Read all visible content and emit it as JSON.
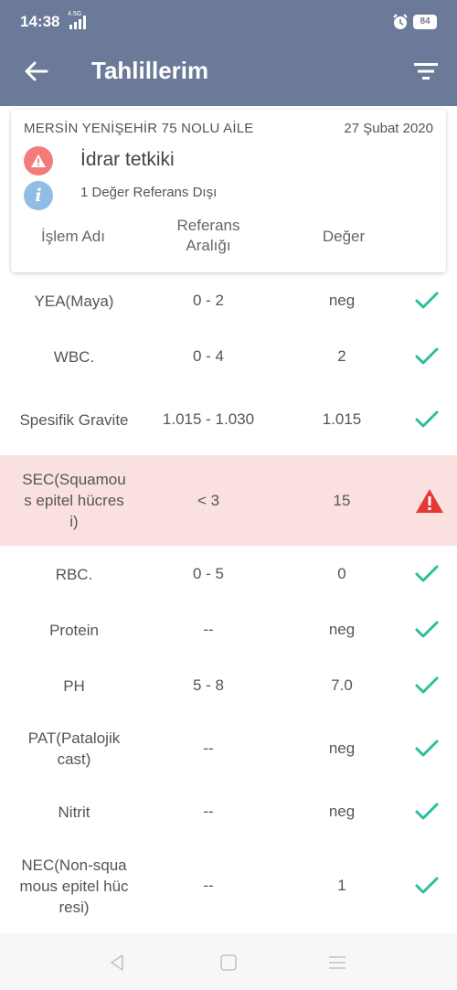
{
  "status_bar": {
    "time": "14:38",
    "network": "4.5G",
    "battery": "84"
  },
  "app_bar": {
    "title": "Tahlillerim"
  },
  "card": {
    "clinic": "MERSİN YENİŞEHİR 75 NOLU AİLE",
    "date": "27 Şubat 2020",
    "test_name": "İdrar tetkiki",
    "reference_summary": "1 Değer Referans Dışı",
    "headers": {
      "name": "İşlem Adı",
      "reference_line1": "Referans",
      "reference_line2": "Aralığı",
      "value": "Değer"
    }
  },
  "rows": [
    {
      "name": "YEA(Maya)",
      "reference": "0 - 2",
      "value": "neg",
      "status": "normal"
    },
    {
      "name": "WBC.",
      "reference": "0 - 4",
      "value": "2",
      "status": "normal"
    },
    {
      "name": "Spesifik Gravite",
      "reference": "1.015 - 1.030",
      "value": "1.015",
      "status": "normal"
    },
    {
      "name": "SEC(Squamous epitel hücresi)",
      "reference": "< 3",
      "value": "15",
      "status": "abnormal"
    },
    {
      "name": "RBC.",
      "reference": "0 - 5",
      "value": "0",
      "status": "normal"
    },
    {
      "name": "Protein",
      "reference": "--",
      "value": "neg",
      "status": "normal"
    },
    {
      "name": "PH",
      "reference": "5 - 8",
      "value": "7.0",
      "status": "normal"
    },
    {
      "name": "PAT(Patalojik cast)",
      "reference": "--",
      "value": "neg",
      "status": "normal"
    },
    {
      "name": "Nitrit",
      "reference": "--",
      "value": "neg",
      "status": "normal"
    },
    {
      "name": "NEC(Non-squamous epitel hücresi)",
      "reference": "--",
      "value": "1",
      "status": "normal"
    }
  ],
  "colors": {
    "header": "#6c7a99",
    "check": "#2bbf9c",
    "warning": "#e53935",
    "abnormal_row": "#fbe0e0"
  }
}
